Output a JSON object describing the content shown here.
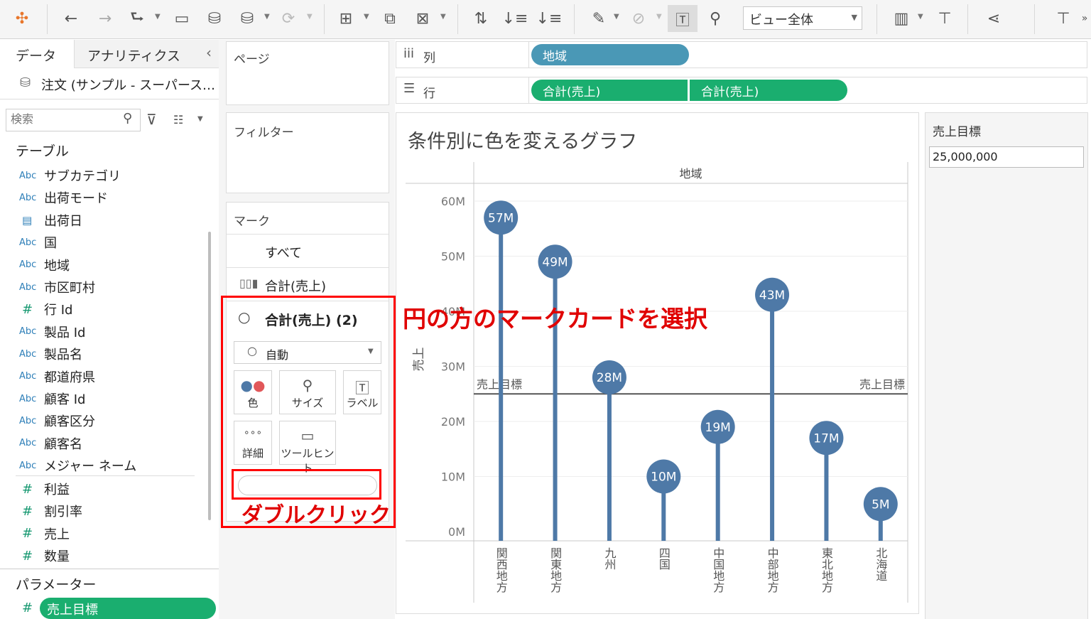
{
  "toolbar": {
    "view_select": "ビュー全体",
    "icons": [
      "tableau-logo-icon",
      "back-arrow-icon",
      "forward-arrow-icon",
      "redo-icon",
      "save-icon",
      "new-datasource-icon",
      "datasource-icon",
      "refresh-icon",
      "new-worksheet-icon",
      "duplicate-icon",
      "clear-sheet-icon",
      "swap-icon",
      "sort-asc-icon",
      "sort-desc-icon",
      "highlight-icon",
      "group-icon",
      "label-toggle-icon",
      "pin-icon",
      "show-me-icon",
      "presentation-icon",
      "share-icon",
      "pointer-icon"
    ]
  },
  "left_pane": {
    "tab_data": "データ",
    "tab_analytics": "アナリティクス",
    "collapse": "‹",
    "datasource": "注文 (サンプル - スーパース…",
    "search_placeholder": "検索",
    "tables_heading": "テーブル",
    "fields": [
      {
        "type": "Abc",
        "name": "サブカテゴリ"
      },
      {
        "type": "Abc",
        "name": "出荷モード"
      },
      {
        "type": "date",
        "name": "出荷日"
      },
      {
        "type": "Abc",
        "name": "国"
      },
      {
        "type": "Abc",
        "name": "地域"
      },
      {
        "type": "Abc",
        "name": "市区町村"
      },
      {
        "type": "#",
        "name": "行 Id"
      },
      {
        "type": "Abc",
        "name": "製品 Id"
      },
      {
        "type": "Abc",
        "name": "製品名"
      },
      {
        "type": "Abc",
        "name": "都道府県"
      },
      {
        "type": "Abc",
        "name": "顧客 Id"
      },
      {
        "type": "Abc",
        "name": "顧客区分"
      },
      {
        "type": "Abc",
        "name": "顧客名"
      },
      {
        "type": "Abc",
        "name": "メジャー ネーム"
      }
    ],
    "measures": [
      {
        "type": "#",
        "name": "利益"
      },
      {
        "type": "#",
        "name": "割引率"
      },
      {
        "type": "#",
        "name": "売上"
      },
      {
        "type": "#",
        "name": "数量"
      }
    ],
    "parameters_heading": "パラメーター",
    "parameter_pill": "売上目標",
    "parameter_type": "#"
  },
  "pages_card": {
    "title": "ページ"
  },
  "filters_card": {
    "title": "フィルター"
  },
  "marks_card": {
    "title": "マーク",
    "all": "すべて",
    "sum_sales": "合計(売上)",
    "sum_sales_2": "合計(売上) (2)",
    "mark_type": "自動",
    "buttons": {
      "color": "色",
      "size": "サイズ",
      "label": "ラベル",
      "detail": "詳細",
      "tooltip": "ツールヒント"
    }
  },
  "shelves": {
    "columns_label": "列",
    "rows_label": "行",
    "column_pill": "地域",
    "row_pills": [
      "合計(売上)",
      "合計(売上)"
    ]
  },
  "parameter_control": {
    "title": "売上目標",
    "value": "25,000,000"
  },
  "annotations": {
    "select_circle_card": "円の方のマークカードを選択",
    "double_click": "ダブルクリック"
  },
  "colors": {
    "pill_blue": "#4a98b6",
    "pill_green": "#1aae6f",
    "mark": "#4e79a7",
    "annotation": "#e00000"
  },
  "chart_data": {
    "type": "lollipop",
    "title": "条件別に色を変えるグラフ",
    "column_header": "地域",
    "ylabel": "売上",
    "categories": [
      "関西地方",
      "関東地方",
      "九州",
      "四国",
      "中国地方",
      "中部地方",
      "東北地方",
      "北海道"
    ],
    "values": [
      57,
      49,
      28,
      10,
      19,
      43,
      17,
      5
    ],
    "labels": [
      "57M",
      "49M",
      "28M",
      "10M",
      "19M",
      "43M",
      "17M",
      "5M"
    ],
    "unit": "M",
    "ylim": [
      0,
      60
    ],
    "yticks": [
      0,
      10,
      20,
      30,
      40,
      50,
      60
    ],
    "ytick_labels": [
      "0M",
      "10M",
      "20M",
      "30M",
      "40M",
      "50M",
      "60M"
    ],
    "reference_line": {
      "value": 25,
      "label_left": "売上目標",
      "label_right": "売上目標"
    },
    "grid": true
  }
}
